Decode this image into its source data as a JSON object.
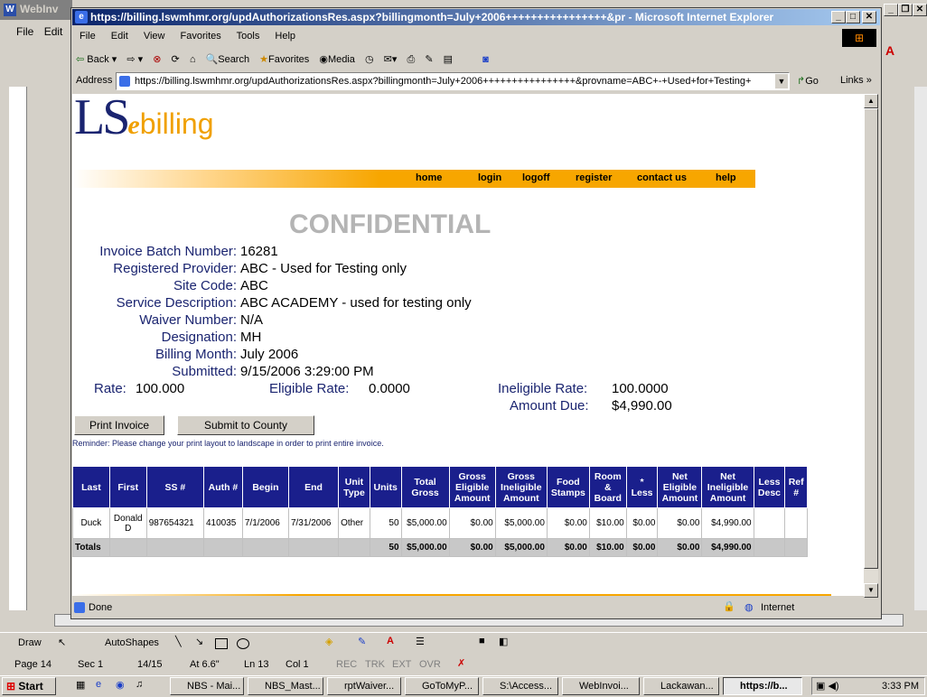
{
  "word": {
    "title": "WebInv",
    "menu_file": "File",
    "menu_edit": "Edit",
    "status": {
      "page": "Page 14",
      "sec": "Sec 1",
      "pages": "14/15",
      "at": "At 6.6\"",
      "ln": "Ln 13",
      "col": "Col 1",
      "rec": "REC",
      "trk": "TRK",
      "ext": "EXT",
      "ovr": "OVR"
    },
    "draw": "Draw",
    "autoshapes": "AutoShapes"
  },
  "ie": {
    "title": "https://billing.lswmhmr.org/updAuthorizationsRes.aspx?billingmonth=July+2006++++++++++++++++&pr - Microsoft Internet Explorer",
    "menu": [
      "File",
      "Edit",
      "View",
      "Favorites",
      "Tools",
      "Help"
    ],
    "toolbar": {
      "back": "Back",
      "search": "Search",
      "favorites": "Favorites",
      "media": "Media"
    },
    "address_label": "Address",
    "address": "https://billing.lswmhmr.org/updAuthorizationsRes.aspx?billingmonth=July+2006++++++++++++++++&provname=ABC+-+Used+for+Testing+",
    "go": "Go",
    "links": "Links",
    "status_text": "Done",
    "zone": "Internet"
  },
  "page": {
    "logo_ls": "LS",
    "logo_e": "e",
    "logo_billing": "billing",
    "nav": [
      "home",
      "login",
      "logoff",
      "register",
      "contact us",
      "help"
    ],
    "heading": "CONFIDENTIAL",
    "fields": [
      {
        "label": "Invoice Batch Number:",
        "value": "16281"
      },
      {
        "label": "Registered Provider:",
        "value": "ABC - Used for Testing only"
      },
      {
        "label": "Site Code:",
        "value": "ABC"
      },
      {
        "label": "Service Description:",
        "value": "ABC ACADEMY - used for testing only"
      },
      {
        "label": "Waiver Number:",
        "value": "N/A"
      },
      {
        "label": "Designation:",
        "value": "MH"
      },
      {
        "label": "Billing Month:",
        "value": "July 2006"
      },
      {
        "label": "Submitted:",
        "value": "9/15/2006 3:29:00 PM"
      }
    ],
    "rate_label": "Rate:",
    "rate": "100.000",
    "eligible_rate_label": "Eligible Rate:",
    "eligible_rate": "0.0000",
    "ineligible_rate_label": "Ineligible Rate:",
    "ineligible_rate": "100.0000",
    "amount_due_label": "Amount Due:",
    "amount_due": "$4,990.00",
    "print_btn": "Print Invoice",
    "submit_btn": "Submit to County",
    "reminder": "Reminder: Please change your print layout to landscape in order to print entire invoice.",
    "table": {
      "headers": [
        "Last",
        "First",
        "SS #",
        "Auth #",
        "Begin",
        "End",
        "Unit Type",
        "Units",
        "Total Gross",
        "Gross Eligible Amount",
        "Gross Ineligible Amount",
        "Food Stamps",
        "Room & Board",
        "* Less",
        "Net Eligible Amount",
        "Net Ineligible Amount",
        "Less Desc",
        "Ref #"
      ],
      "row": [
        "Duck",
        "Donald D",
        "987654321",
        "410035",
        "7/1/2006",
        "7/31/2006",
        "Other",
        "50",
        "$5,000.00",
        "$0.00",
        "$5,000.00",
        "$0.00",
        "$10.00",
        "$0.00",
        "$0.00",
        "$4,990.00",
        "",
        ""
      ],
      "totals": [
        "Totals",
        "",
        "",
        "",
        "",
        "",
        "",
        "50",
        "$5,000.00",
        "$0.00",
        "$5,000.00",
        "$0.00",
        "$10.00",
        "$0.00",
        "$0.00",
        "$4,990.00",
        "",
        ""
      ]
    }
  },
  "taskbar": {
    "start": "Start",
    "items": [
      "NBS - Mai...",
      "NBS_Mast...",
      "rptWaiver...",
      "GoToMyP...",
      "S:\\Access...",
      "WebInvoi...",
      "Lackawan...",
      "https://b..."
    ],
    "clock": "3:33 PM"
  }
}
